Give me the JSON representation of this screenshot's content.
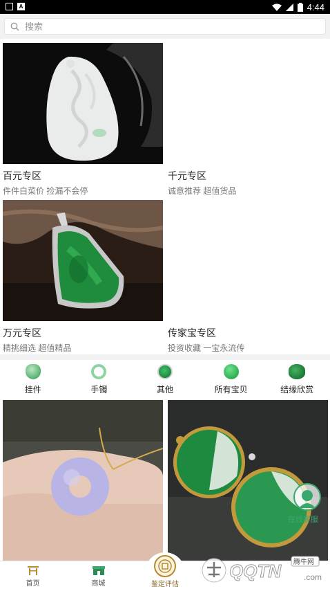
{
  "status_bar": {
    "time": "4:44"
  },
  "search": {
    "placeholder": "搜索"
  },
  "zones": [
    {
      "title": "百元专区",
      "subtitle": "件件白菜价 捡漏不会停"
    },
    {
      "title": "千元专区",
      "subtitle": "诚意推荐 超值货品"
    },
    {
      "title": "万元专区",
      "subtitle": "精挑细选 超值精品"
    },
    {
      "title": "传家宝专区",
      "subtitle": "投资收藏 一宝永流传"
    }
  ],
  "categories": [
    {
      "label": "挂件",
      "icon": "jade-pendant-icon"
    },
    {
      "label": "手镯",
      "icon": "jade-bangle-icon"
    },
    {
      "label": "其他",
      "icon": "jade-ring-icon"
    },
    {
      "label": "所有宝贝",
      "icon": "jade-bead-icon"
    },
    {
      "label": "结缘欣赏",
      "icon": "jade-stone-icon"
    }
  ],
  "gallery_badge": "在线客服",
  "tabbar": {
    "home": "首页",
    "mall": "商城",
    "appraise": "鉴定评估"
  },
  "watermark": {
    "site": "QQTN",
    "sub": "腾牛网",
    "extra": ".com"
  }
}
